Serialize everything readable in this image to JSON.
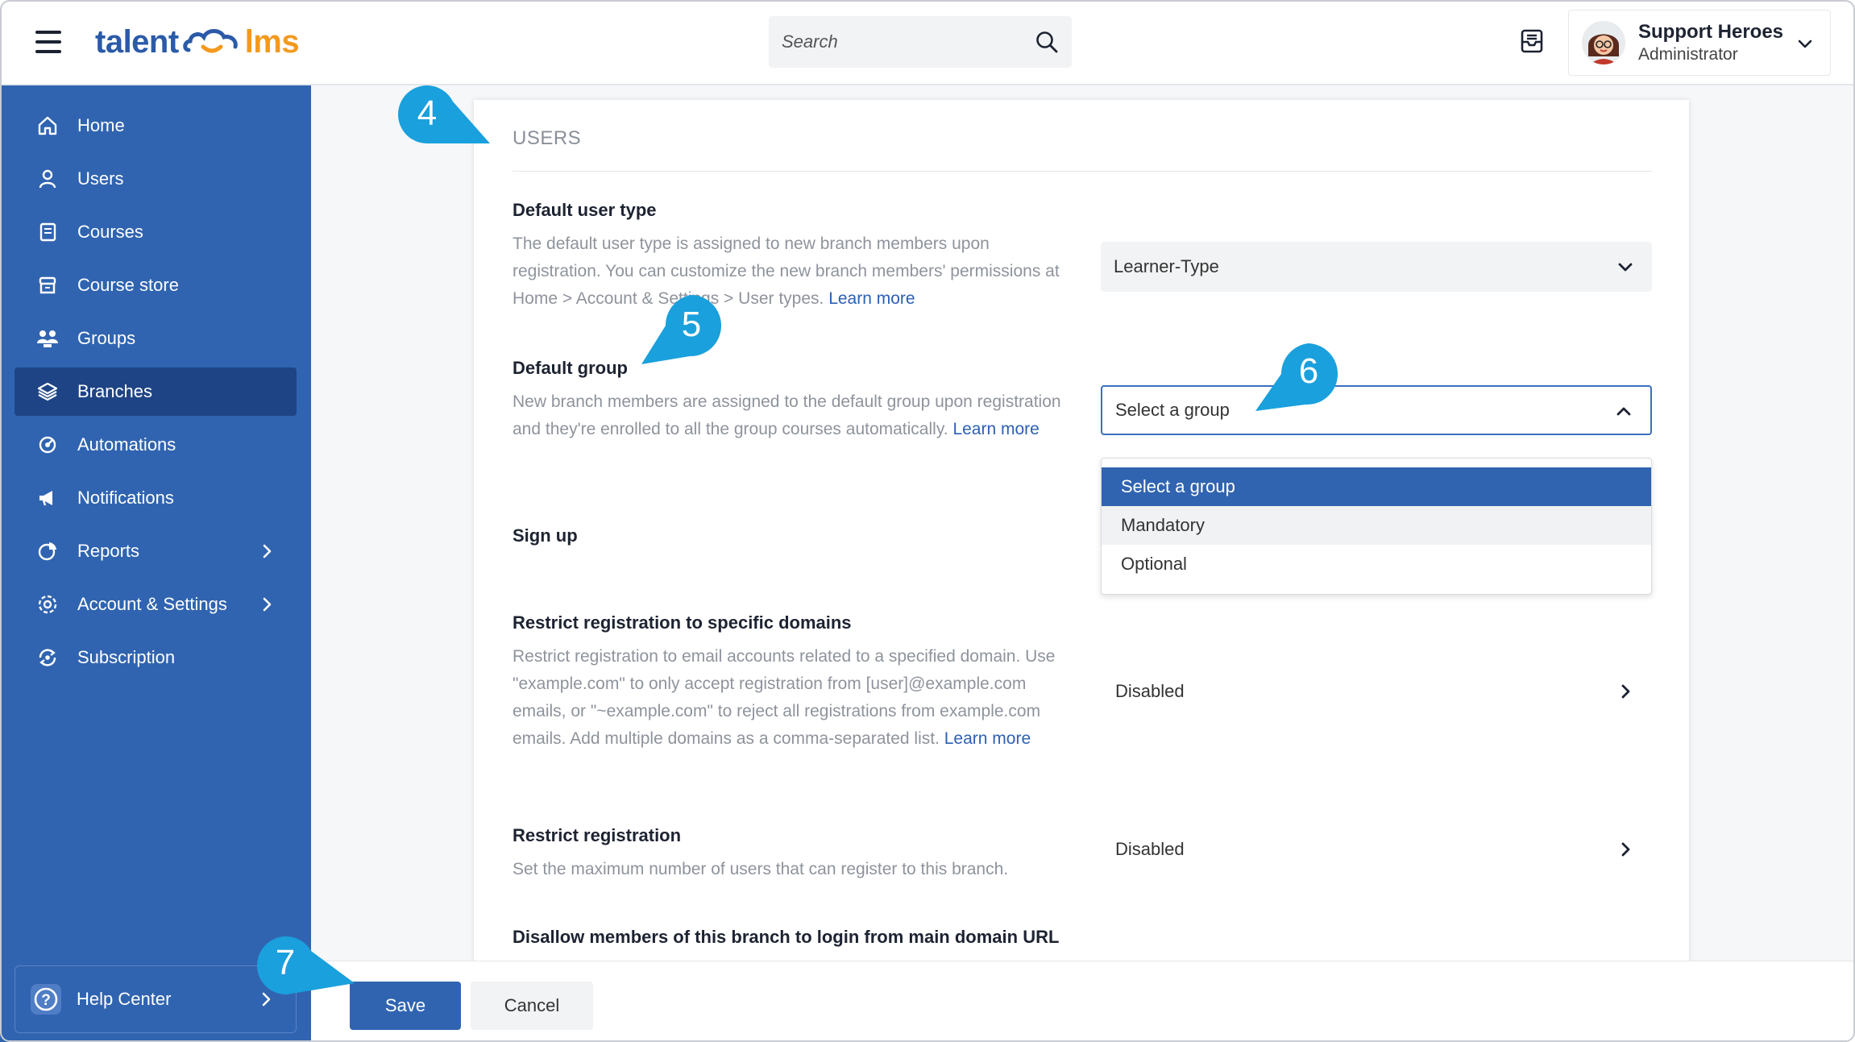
{
  "header": {
    "logo_text_left": "talent",
    "logo_text_right": "lms",
    "search_placeholder": "Search",
    "user_name": "Support Heroes",
    "user_role": "Administrator"
  },
  "sidebar": {
    "items": [
      {
        "label": "Home",
        "icon": "home-icon"
      },
      {
        "label": "Users",
        "icon": "user-icon"
      },
      {
        "label": "Courses",
        "icon": "book-icon"
      },
      {
        "label": "Course store",
        "icon": "store-icon"
      },
      {
        "label": "Groups",
        "icon": "groups-icon"
      },
      {
        "label": "Branches",
        "icon": "layers-icon",
        "active": true
      },
      {
        "label": "Automations",
        "icon": "automation-icon"
      },
      {
        "label": "Notifications",
        "icon": "megaphone-icon"
      },
      {
        "label": "Reports",
        "icon": "pie-chart-icon",
        "has_submenu": true
      },
      {
        "label": "Account & Settings",
        "icon": "gear-icon",
        "has_submenu": true
      },
      {
        "label": "Subscription",
        "icon": "subscription-icon"
      }
    ],
    "help_center": "Help Center"
  },
  "main": {
    "section_title": "USERS",
    "default_user_type": {
      "title": "Default user type",
      "description": "The default user type is assigned to new branch members upon registration. You can customize the new branch members' permissions at Home > Account & Settings > User types.",
      "learn_more": "Learn more",
      "value": "Learner-Type"
    },
    "default_group": {
      "title": "Default group",
      "description": "New branch members are assigned to the default group upon registration and they're enrolled to all the group courses automatically.",
      "learn_more": "Learn more",
      "value": "Select a group",
      "options": [
        "Select a group",
        "Mandatory",
        "Optional"
      ]
    },
    "sign_up": {
      "title": "Sign up"
    },
    "restrict_domains": {
      "title": "Restrict registration to specific domains",
      "description": "Restrict registration to email accounts related to a specified domain. Use \"example.com\" to only accept registration from [user]@example.com emails, or \"~example.com\" to reject all registrations from example.com emails. Add multiple domains as a comma-separated list.",
      "learn_more": "Learn more",
      "value": "Disabled"
    },
    "restrict_registration": {
      "title": "Restrict registration",
      "description": "Set the maximum number of users that can register to this branch.",
      "value": "Disabled"
    },
    "disallow_login": {
      "title": "Disallow members of this branch to login from main domain URL"
    }
  },
  "footer": {
    "save_label": "Save",
    "cancel_label": "Cancel"
  },
  "callouts": [
    "4",
    "5",
    "6",
    "7"
  ],
  "colors": {
    "sidebar": "#3064b0",
    "sidebar_active": "#1f4486",
    "primary": "#3064b0",
    "callout": "#1aa0dc",
    "logo_blue": "#2b5aa8",
    "logo_orange": "#f39a1e"
  }
}
